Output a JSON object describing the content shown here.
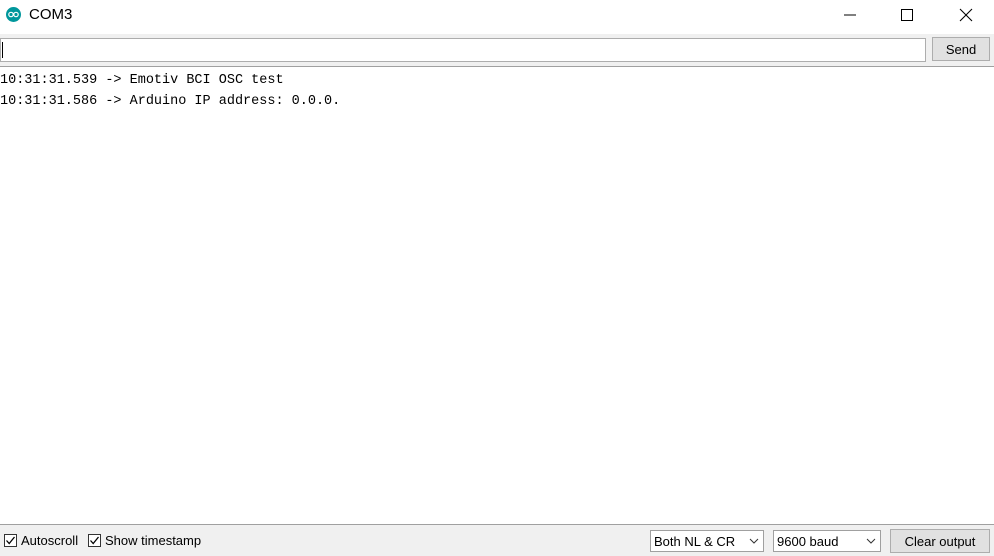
{
  "window": {
    "title": "COM3",
    "app_icon": "arduino-icon",
    "controls": {
      "minimize_icon": "minimize-icon",
      "maximize_icon": "maximize-icon",
      "close_icon": "close-icon"
    }
  },
  "send_row": {
    "input_value": "",
    "send_label": "Send"
  },
  "output": {
    "lines": [
      "10:31:31.539 -> Emotiv BCI OSC test",
      "10:31:31.586 -> Arduino IP address: 0.0.0."
    ]
  },
  "footer": {
    "autoscroll": {
      "label": "Autoscroll",
      "checked": true
    },
    "show_timestamp": {
      "label": "Show timestamp",
      "checked": true
    },
    "line_ending": "Both NL & CR",
    "baud_rate": "9600 baud",
    "clear_label": "Clear output"
  },
  "colors": {
    "accent": "#00979c",
    "chrome": "#f0f0f0",
    "button": "#e1e1e1"
  }
}
